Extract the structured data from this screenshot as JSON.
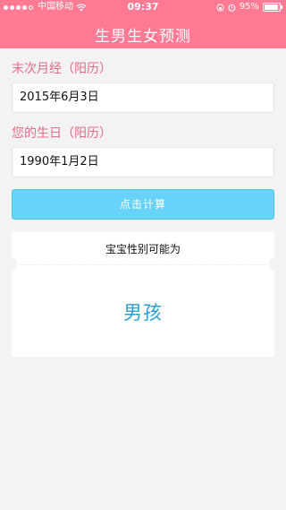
{
  "status_bar": {
    "carrier": "中国移动",
    "time": "09:37",
    "battery_percent": "95%",
    "battery_level": 0.95
  },
  "header": {
    "title": "生男生女预测"
  },
  "form": {
    "last_period_label": "末次月经（阳历）",
    "last_period_value": "2015年6月3日",
    "birthday_label": "您的生日（阳历）",
    "birthday_value": "1990年1月2日",
    "calculate_label": "点击计算"
  },
  "result": {
    "title": "宝宝性别可能为",
    "value": "男孩"
  },
  "colors": {
    "header": "#ff7a92",
    "label": "#e56c86",
    "button": "#67d3f8",
    "result_value": "#2a9fd8"
  },
  "icons": [
    "signal-dots-icon",
    "wifi-icon",
    "lock-rotation-icon",
    "alarm-icon",
    "battery-icon"
  ]
}
